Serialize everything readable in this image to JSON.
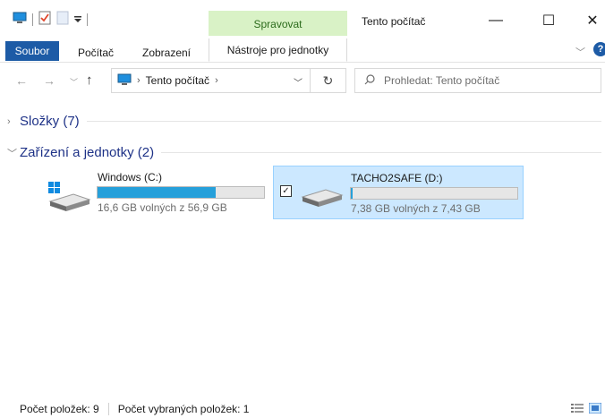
{
  "window": {
    "context_tab_header": "Spravovat",
    "title": "Tento počítač",
    "minimize_glyph": "—",
    "maximize_glyph": "☐",
    "close_glyph": "✕"
  },
  "quick_access": {
    "icons": [
      "computer-icon",
      "properties-icon",
      "new-folder-icon",
      "customize-dropdown-icon"
    ]
  },
  "ribbon": {
    "tabs": [
      {
        "label": "Soubor",
        "active": true
      },
      {
        "label": "Počítač"
      },
      {
        "label": "Zobrazení"
      },
      {
        "label": "Nástroje pro jednotky"
      }
    ],
    "expand_glyph": "﹀",
    "help_glyph": "?"
  },
  "navigation": {
    "back_glyph": "←",
    "forward_glyph": "→",
    "recent_glyph": "﹀",
    "up_glyph": "↑",
    "address_separator": "›",
    "address_location": "Tento počítač",
    "address_trailing_separator": "›",
    "address_dropdown_glyph": "﹀",
    "refresh_glyph": "↻",
    "search_glyph": "⚲",
    "search_placeholder": "Prohledat: Tento počítač"
  },
  "groups": [
    {
      "chevron": "›",
      "label": "Složky (7)",
      "collapsed": true
    },
    {
      "chevron": "﹀",
      "label": "Zařízení a jednotky (2)",
      "collapsed": false
    }
  ],
  "drives": [
    {
      "name": "Windows (C:)",
      "size_text": "16,6 GB volných z 56,9 GB",
      "used_fraction": 0.708,
      "selected": false,
      "icon": "windows-drive-icon"
    },
    {
      "name": "TACHO2SAFE (D:)",
      "size_text": "7,38 GB volných z 7,43 GB",
      "used_fraction": 0.007,
      "selected": true,
      "check_glyph": "✓",
      "icon": "removable-drive-icon"
    }
  ],
  "status": {
    "item_count": "Počet položek: 9",
    "selected_count": "Počet vybraných položek: 1"
  },
  "colors": {
    "accent": "#1d5ba6",
    "context_tab": "#d9f2c6",
    "usage_bar": "#26a0da",
    "selection_bg": "#cce8ff",
    "group_header": "#1e3287"
  }
}
